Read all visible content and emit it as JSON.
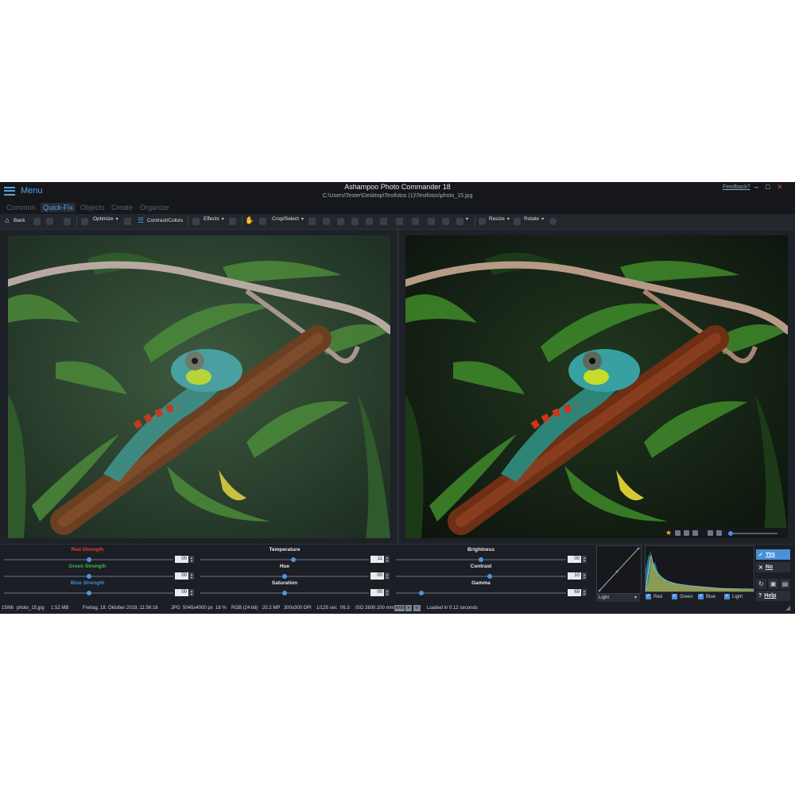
{
  "window": {
    "menu_label": "Menu",
    "title": "Ashampoo Photo Commander 18",
    "path": "C:\\Users\\Tester\\Desktop\\Testfotos (1)\\Testfotos\\photo_15.jpg",
    "feedback": "Feedback?",
    "controls": {
      "minimize": "–",
      "maximize": "□",
      "close": "✕"
    }
  },
  "tabs": [
    {
      "label": "Common",
      "active": false
    },
    {
      "label": "Quick-Fix",
      "active": true
    },
    {
      "label": "Objects",
      "active": false
    },
    {
      "label": "Create",
      "active": false
    },
    {
      "label": "Organize",
      "active": false
    }
  ],
  "toolbar": {
    "back": "Back",
    "optimize": "Optimize",
    "contrast_colors": "Contrast/Colors",
    "effects": "Effects",
    "crop_select": "Crop/Select",
    "resize": "Resize",
    "rotate": "Rotate"
  },
  "adjustments": {
    "red": {
      "label": "Red Strength",
      "value": "00",
      "color": "#e0402a",
      "level": 0.5
    },
    "green": {
      "label": "Green Strength",
      "value": "00",
      "color": "#3fb24a",
      "level": 0.5
    },
    "blue": {
      "label": "Blue Strength",
      "value": "00",
      "color": "#3e8ee0",
      "level": 0.5
    },
    "temperature": {
      "label": "Temperature",
      "value": "11",
      "level": 0.55
    },
    "hue": {
      "label": "Hue",
      "value": "00",
      "level": 0.5
    },
    "saturation": {
      "label": "Saturation",
      "value": "00",
      "level": 0.5
    },
    "brightness": {
      "label": "Brightness",
      "value": "00",
      "level": 0.5
    },
    "contrast": {
      "label": "Contrast",
      "value": "10",
      "level": 0.55
    },
    "gamma": {
      "label": "Gamma",
      "value": "69",
      "level": 0.15
    }
  },
  "curve": {
    "channel": "Light"
  },
  "histogram": {
    "checks": [
      {
        "label": "Red",
        "checked": true
      },
      {
        "label": "Green",
        "checked": true
      },
      {
        "label": "Blue",
        "checked": true
      },
      {
        "label": "Light",
        "checked": true
      }
    ]
  },
  "actions": {
    "yes": "Yes",
    "no": "No",
    "help": "Help"
  },
  "status": {
    "index": "15/66",
    "filename": "photo_15.jpg",
    "filesize": "1.52 MB",
    "date": "Freitag, 18. Oktober 2019, 11:56:16",
    "format": "JPG",
    "dimensions": "5045x4000 px",
    "zoom": "18 %",
    "color": "RGB (24 bit)",
    "megapixels": "20.2 MP",
    "dpi": "300x300 DPI",
    "shutter": "1/125 sec",
    "aperture": "f/6.3",
    "iso": "ISO 2800",
    "focal": "200 mm",
    "wb_badge": "AWB",
    "loaded": "Loaded in 0.12 seconds"
  },
  "colors": {
    "accent": "#4a8fd8",
    "panel_bg": "#1b1e24",
    "titlebar_bg": "#15171b"
  }
}
